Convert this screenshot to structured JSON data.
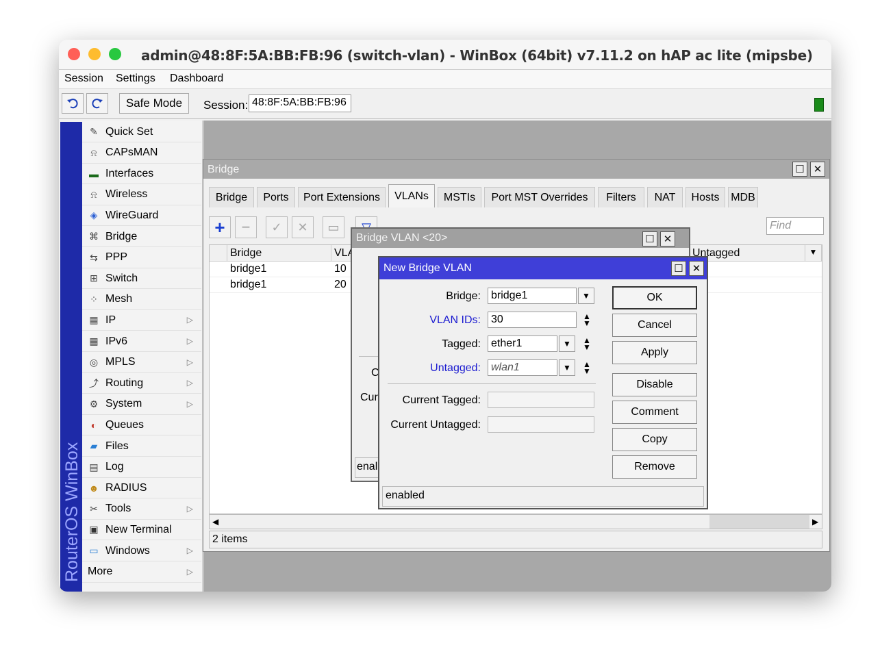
{
  "window": {
    "title": "admin@48:8F:5A:BB:FB:96 (switch-vlan) - WinBox (64bit) v7.11.2 on hAP ac lite (mipsbe)"
  },
  "menu": [
    "Session",
    "Settings",
    "Dashboard"
  ],
  "toolbar": {
    "undo_icon": "undo-icon",
    "redo_icon": "redo-icon",
    "safe_mode": "Safe Mode",
    "session_label": "Session:",
    "session_value": "48:8F:5A:BB:FB:96"
  },
  "brand": "RouterOS WinBox",
  "sidebar": {
    "items": [
      {
        "label": "Quick Set",
        "icon": "wand-icon",
        "submenu": false
      },
      {
        "label": "CAPsMAN",
        "icon": "antenna-icon",
        "submenu": false
      },
      {
        "label": "Interfaces",
        "icon": "interfaces-icon",
        "submenu": false
      },
      {
        "label": "Wireless",
        "icon": "antenna-icon",
        "submenu": false
      },
      {
        "label": "WireGuard",
        "icon": "wireguard-icon",
        "submenu": false
      },
      {
        "label": "Bridge",
        "icon": "bridge-icon",
        "submenu": false
      },
      {
        "label": "PPP",
        "icon": "ppp-icon",
        "submenu": false
      },
      {
        "label": "Switch",
        "icon": "switch-icon",
        "submenu": false
      },
      {
        "label": "Mesh",
        "icon": "mesh-icon",
        "submenu": false
      },
      {
        "label": "IP",
        "icon": "ip-icon",
        "submenu": true
      },
      {
        "label": "IPv6",
        "icon": "ipv6-icon",
        "submenu": true
      },
      {
        "label": "MPLS",
        "icon": "mpls-icon",
        "submenu": true
      },
      {
        "label": "Routing",
        "icon": "routing-icon",
        "submenu": true
      },
      {
        "label": "System",
        "icon": "gear-icon",
        "submenu": true
      },
      {
        "label": "Queues",
        "icon": "queues-icon",
        "submenu": false
      },
      {
        "label": "Files",
        "icon": "folder-icon",
        "submenu": false
      },
      {
        "label": "Log",
        "icon": "log-icon",
        "submenu": false
      },
      {
        "label": "RADIUS",
        "icon": "users-icon",
        "submenu": false
      },
      {
        "label": "Tools",
        "icon": "tools-icon",
        "submenu": true
      },
      {
        "label": "New Terminal",
        "icon": "terminal-icon",
        "submenu": false
      },
      {
        "label": "Windows",
        "icon": "windows-icon",
        "submenu": true
      },
      {
        "label": "More",
        "icon": "",
        "submenu": true
      }
    ]
  },
  "bridge_window": {
    "title": "Bridge",
    "tabs": [
      "Bridge",
      "Ports",
      "Port Extensions",
      "VLANs",
      "MSTIs",
      "Port MST Overrides",
      "Filters",
      "NAT",
      "Hosts",
      "MDB"
    ],
    "active_tab": "VLANs",
    "find_placeholder": "Find",
    "columns": [
      "Bridge",
      "VLA",
      "Untagged"
    ],
    "rows": [
      {
        "bridge": "bridge1",
        "vlan": "10"
      },
      {
        "bridge": "bridge1",
        "vlan": "20"
      }
    ],
    "status": "2 items"
  },
  "vlan20_dialog": {
    "title": "Bridge VLAN <20>",
    "partial_c": "C",
    "partial_cur": "Cur",
    "partial_status": "enal"
  },
  "new_vlan_dialog": {
    "title": "New Bridge VLAN",
    "fields": {
      "bridge_label": "Bridge:",
      "bridge_value": "bridge1",
      "vlan_ids_label": "VLAN IDs:",
      "vlan_ids_value": "30",
      "tagged_label": "Tagged:",
      "tagged_value": "ether1",
      "untagged_label": "Untagged:",
      "untagged_value": "wlan1",
      "current_tagged_label": "Current Tagged:",
      "current_tagged_value": "",
      "current_untagged_label": "Current Untagged:",
      "current_untagged_value": ""
    },
    "buttons": [
      "OK",
      "Cancel",
      "Apply",
      "Disable",
      "Comment",
      "Copy",
      "Remove"
    ],
    "status": "enabled"
  },
  "colors": {
    "brandbar": "#1e2aa8",
    "active_dialog_title": "#3f3fd8",
    "inactive_title": "#a9a9a9",
    "field_label_blue": "#1a1ad0",
    "status_led": "#1a8a1a"
  }
}
